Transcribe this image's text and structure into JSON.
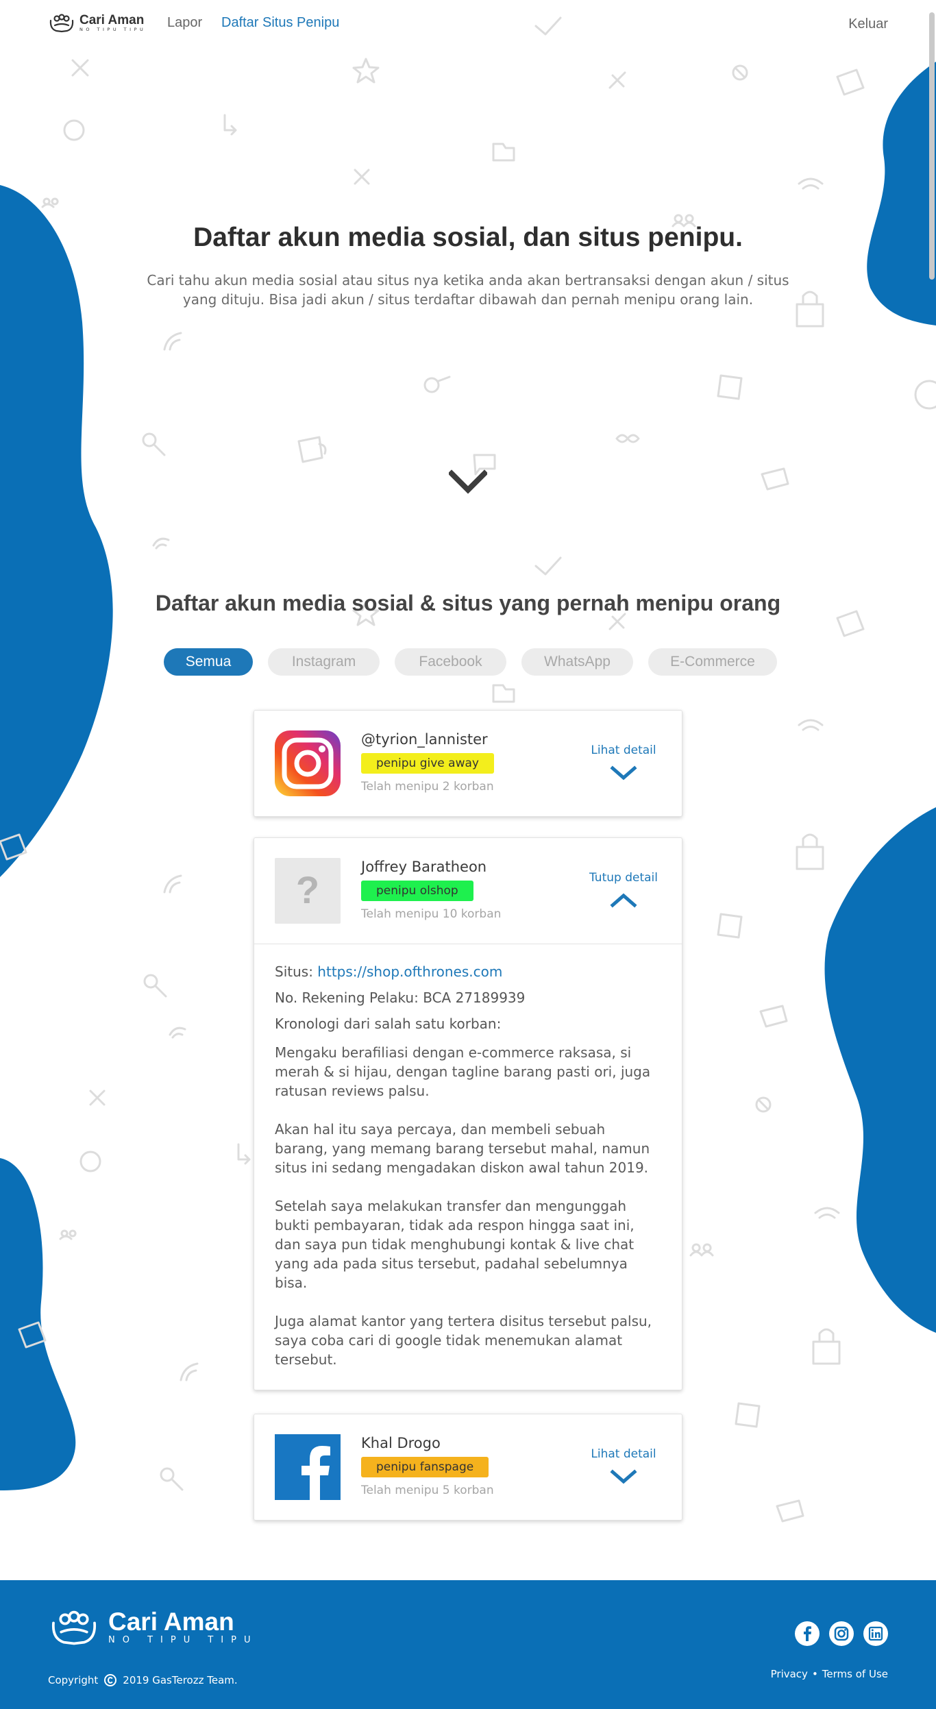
{
  "nav": {
    "brand": "Cari Aman",
    "tagline": "NO TIPU TIPU",
    "links": [
      {
        "label": "Lapor",
        "active": false
      },
      {
        "label": "Daftar Situs Penipu",
        "active": true
      }
    ],
    "logout": "Keluar"
  },
  "hero": {
    "title": "Daftar akun media sosial, dan situs penipu.",
    "description": "Cari tahu akun media sosial atau situs nya ketika anda akan bertransaksi dengan akun / situs yang dituju. Bisa jadi akun / situs terdaftar dibawah dan pernah menipu orang lain."
  },
  "section": {
    "title": "Daftar akun media sosial & situs yang pernah menipu orang",
    "filters": [
      "Semua",
      "Instagram",
      "Facebook",
      "WhatsApp",
      "E-Commerce"
    ],
    "active_filter": "Semua"
  },
  "cards": [
    {
      "name": "@tyrion_lannister",
      "badge": "penipu give away",
      "badge_color": "#f3ee1c",
      "count": "Telah menipu 2 korban",
      "detail": "Lihat detail",
      "platform_icon": "instagram-icon",
      "expanded": false
    },
    {
      "name": "Joffrey Baratheon",
      "badge": "penipu olshop",
      "badge_color": "#1ef04e",
      "count": "Telah menipu 10 korban",
      "detail": "Tutup detail",
      "platform_icon": "unknown-icon",
      "expanded": true,
      "site_label": "Situs:",
      "site_url": "https://shop.ofthrones.com",
      "account": "No. Rekening Pelaku: BCA 27189939",
      "chronology_label": "Kronologi dari salah satu korban:",
      "story": [
        "Mengaku berafiliasi dengan e-commerce raksasa, si merah & si hijau, dengan tagline barang pasti ori, juga ratusan reviews palsu.",
        "Akan hal itu saya percaya, dan membeli sebuah barang, yang memang barang tersebut mahal, namun situs ini sedang mengadakan diskon awal tahun 2019.",
        "Setelah saya melakukan transfer dan mengunggah bukti pembayaran, tidak ada respon hingga saat ini, dan saya pun tidak menghubungi kontak & live chat yang ada pada situs tersebut, padahal sebelumnya bisa.",
        "Juga alamat kantor yang tertera disitus tersebut palsu, saya coba cari di google tidak menemukan alamat tersebut."
      ]
    },
    {
      "name": "Khal Drogo",
      "badge": "penipu fanspage",
      "badge_color": "#f5b21d",
      "count": "Telah menipu 5 korban",
      "detail": "Lihat detail",
      "platform_icon": "facebook-icon",
      "expanded": false
    }
  ],
  "footer": {
    "brand": "Cari Aman",
    "tagline": "NO TIPU TIPU",
    "copyright": "Copyright",
    "copyright_text": "2019 GasTerozz Team.",
    "social": [
      "facebook-icon",
      "instagram-icon",
      "linkedin-icon"
    ],
    "links": [
      "Privacy",
      "Terms of Use"
    ],
    "separator": "•"
  },
  "colors": {
    "primary": "#1e78b8",
    "blob": "#0a6fb6",
    "footer": "#0a6fb6"
  }
}
